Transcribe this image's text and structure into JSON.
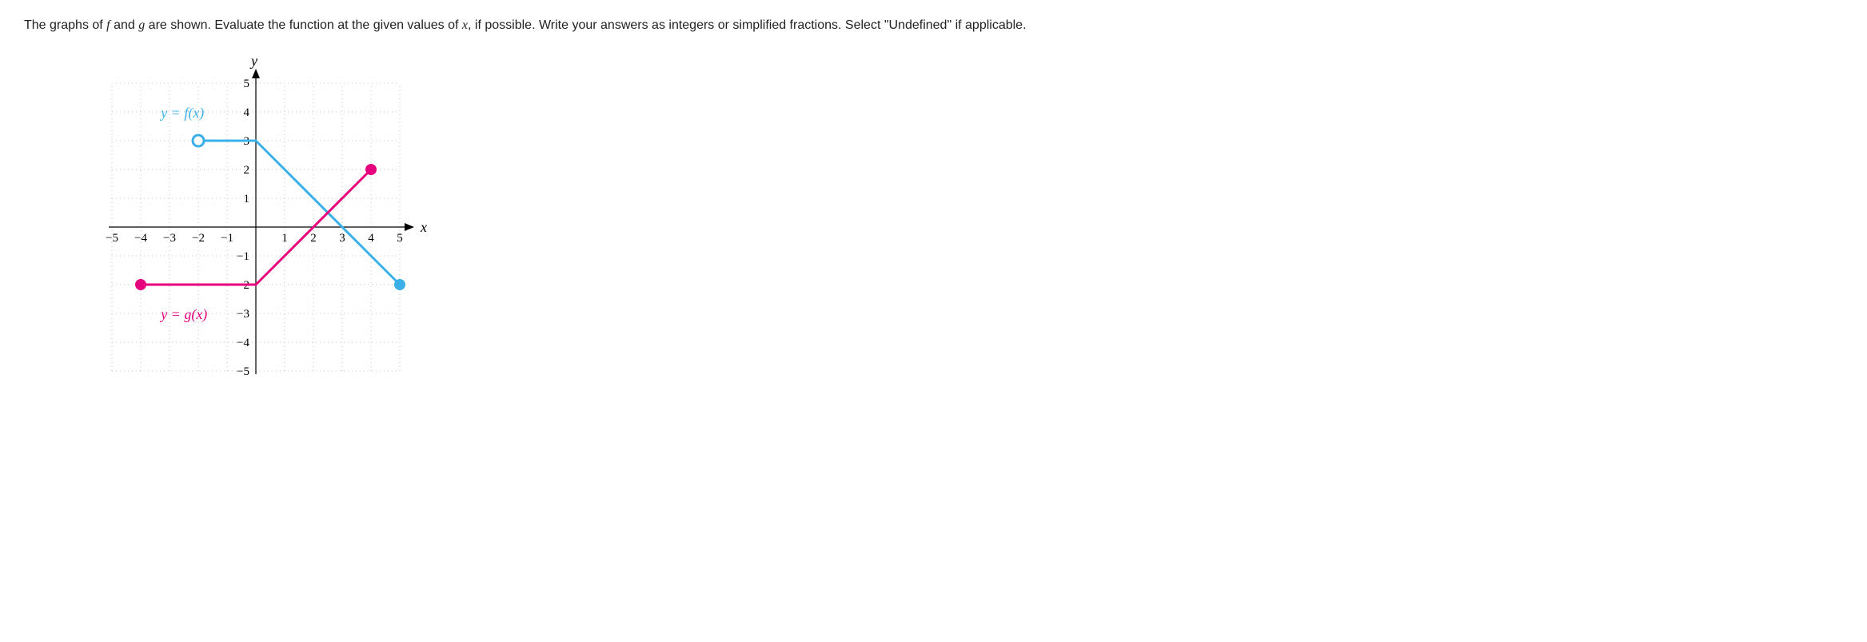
{
  "prompt": {
    "prefix": "The graphs of ",
    "f": "f",
    "and": " and ",
    "g": "g",
    "mid": " are shown. Evaluate the function at the given values of ",
    "x": "x",
    "suffix": ", if possible. Write your answers as integers or simplified fractions. Select \"Undefined\" if applicable."
  },
  "chart_data": {
    "type": "line",
    "title": "",
    "xlabel": "x",
    "ylabel": "y",
    "xlim": [
      -5,
      5
    ],
    "ylim": [
      -5,
      5
    ],
    "x_ticks": [
      -5,
      -4,
      -3,
      -2,
      -1,
      1,
      2,
      3,
      4,
      5
    ],
    "y_ticks": [
      -5,
      -4,
      -3,
      -2,
      -1,
      1,
      2,
      3,
      4,
      5
    ],
    "series": [
      {
        "name": "y = f(x)",
        "color": "#3bb0e8",
        "segments": [
          {
            "points": [
              [
                -2,
                3
              ],
              [
                0,
                3
              ]
            ],
            "start": "open",
            "end": "none"
          },
          {
            "points": [
              [
                0,
                3
              ],
              [
                5,
                -2
              ]
            ],
            "start": "none",
            "end": "closed"
          }
        ]
      },
      {
        "name": "y = g(x)",
        "color": "#e6007e",
        "segments": [
          {
            "points": [
              [
                -4,
                -2
              ],
              [
                0,
                -2
              ]
            ],
            "start": "closed",
            "end": "none"
          },
          {
            "points": [
              [
                0,
                -2
              ],
              [
                4,
                2
              ]
            ],
            "start": "none",
            "end": "closed"
          }
        ]
      }
    ],
    "labels": {
      "f": "y = f(x)",
      "g": "y = g(x)"
    }
  }
}
